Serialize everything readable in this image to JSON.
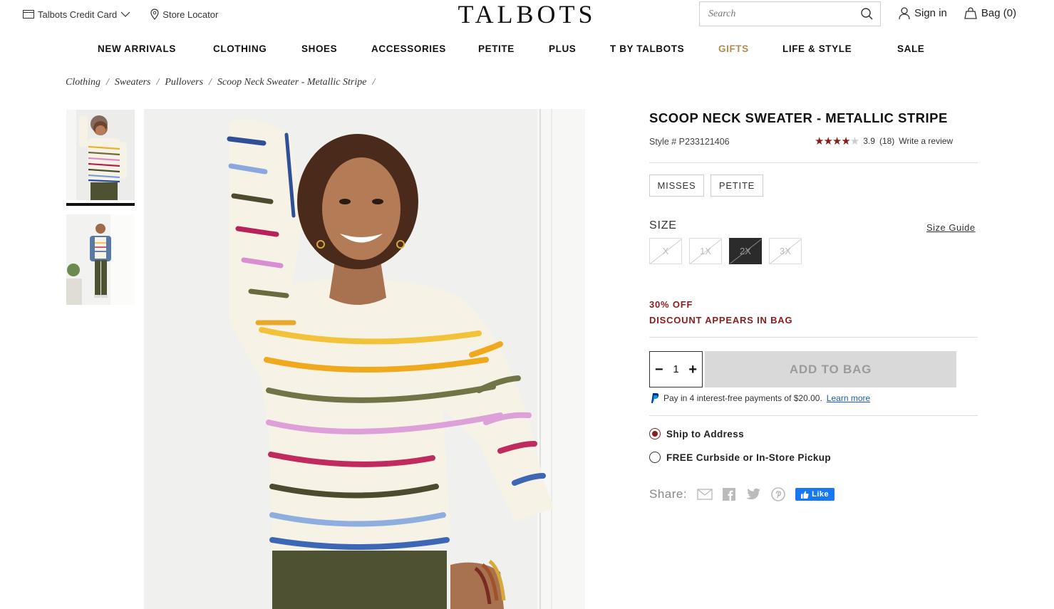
{
  "utility": {
    "credit_card": "Talbots Credit Card",
    "store_locator": "Store Locator",
    "logo": "TALBOTS",
    "search_placeholder": "Search",
    "sign_in": "Sign in",
    "bag": "Bag (0)"
  },
  "nav": {
    "items": [
      "NEW ARRIVALS",
      "CLOTHING",
      "SHOES",
      "ACCESSORIES",
      "PETITE",
      "PLUS",
      "T BY TALBOTS",
      "GIFTS",
      "LIFE & STYLE",
      "SALE"
    ]
  },
  "breadcrumb": [
    "Clothing",
    "Sweaters",
    "Pullovers",
    "Scoop Neck Sweater - Metallic Stripe"
  ],
  "product": {
    "title": "SCOOP NECK SWEATER - METALLIC STRIPE",
    "style": "Style # P233121406",
    "rating_value": "3.9",
    "rating_count": "(18)",
    "rating_stars": 3.9,
    "write_review": "Write a review",
    "fits": [
      "MISSES",
      "PETITE"
    ],
    "size_label": "SIZE",
    "size_guide": "Size Guide",
    "sizes": [
      "X",
      "1X",
      "2X",
      "3X"
    ],
    "selected_size": "2X",
    "promo_line1": "30% OFF",
    "promo_line2": "DISCOUNT APPEARS IN BAG",
    "quantity": "1",
    "add_to_bag": "ADD TO BAG",
    "paypal_text": "Pay in 4 interest-free payments of $20.00.",
    "paypal_link": "Learn more",
    "ship_to_address": "Ship to Address",
    "pickup": "FREE Curbside or In-Store Pickup",
    "share_label": "Share:",
    "like_label": "Like"
  },
  "colors": {
    "accent": "#8b1c1c",
    "gifts": "#b08d4e",
    "paypal_link": "#1a5fb4",
    "facebook": "#1877f2"
  }
}
